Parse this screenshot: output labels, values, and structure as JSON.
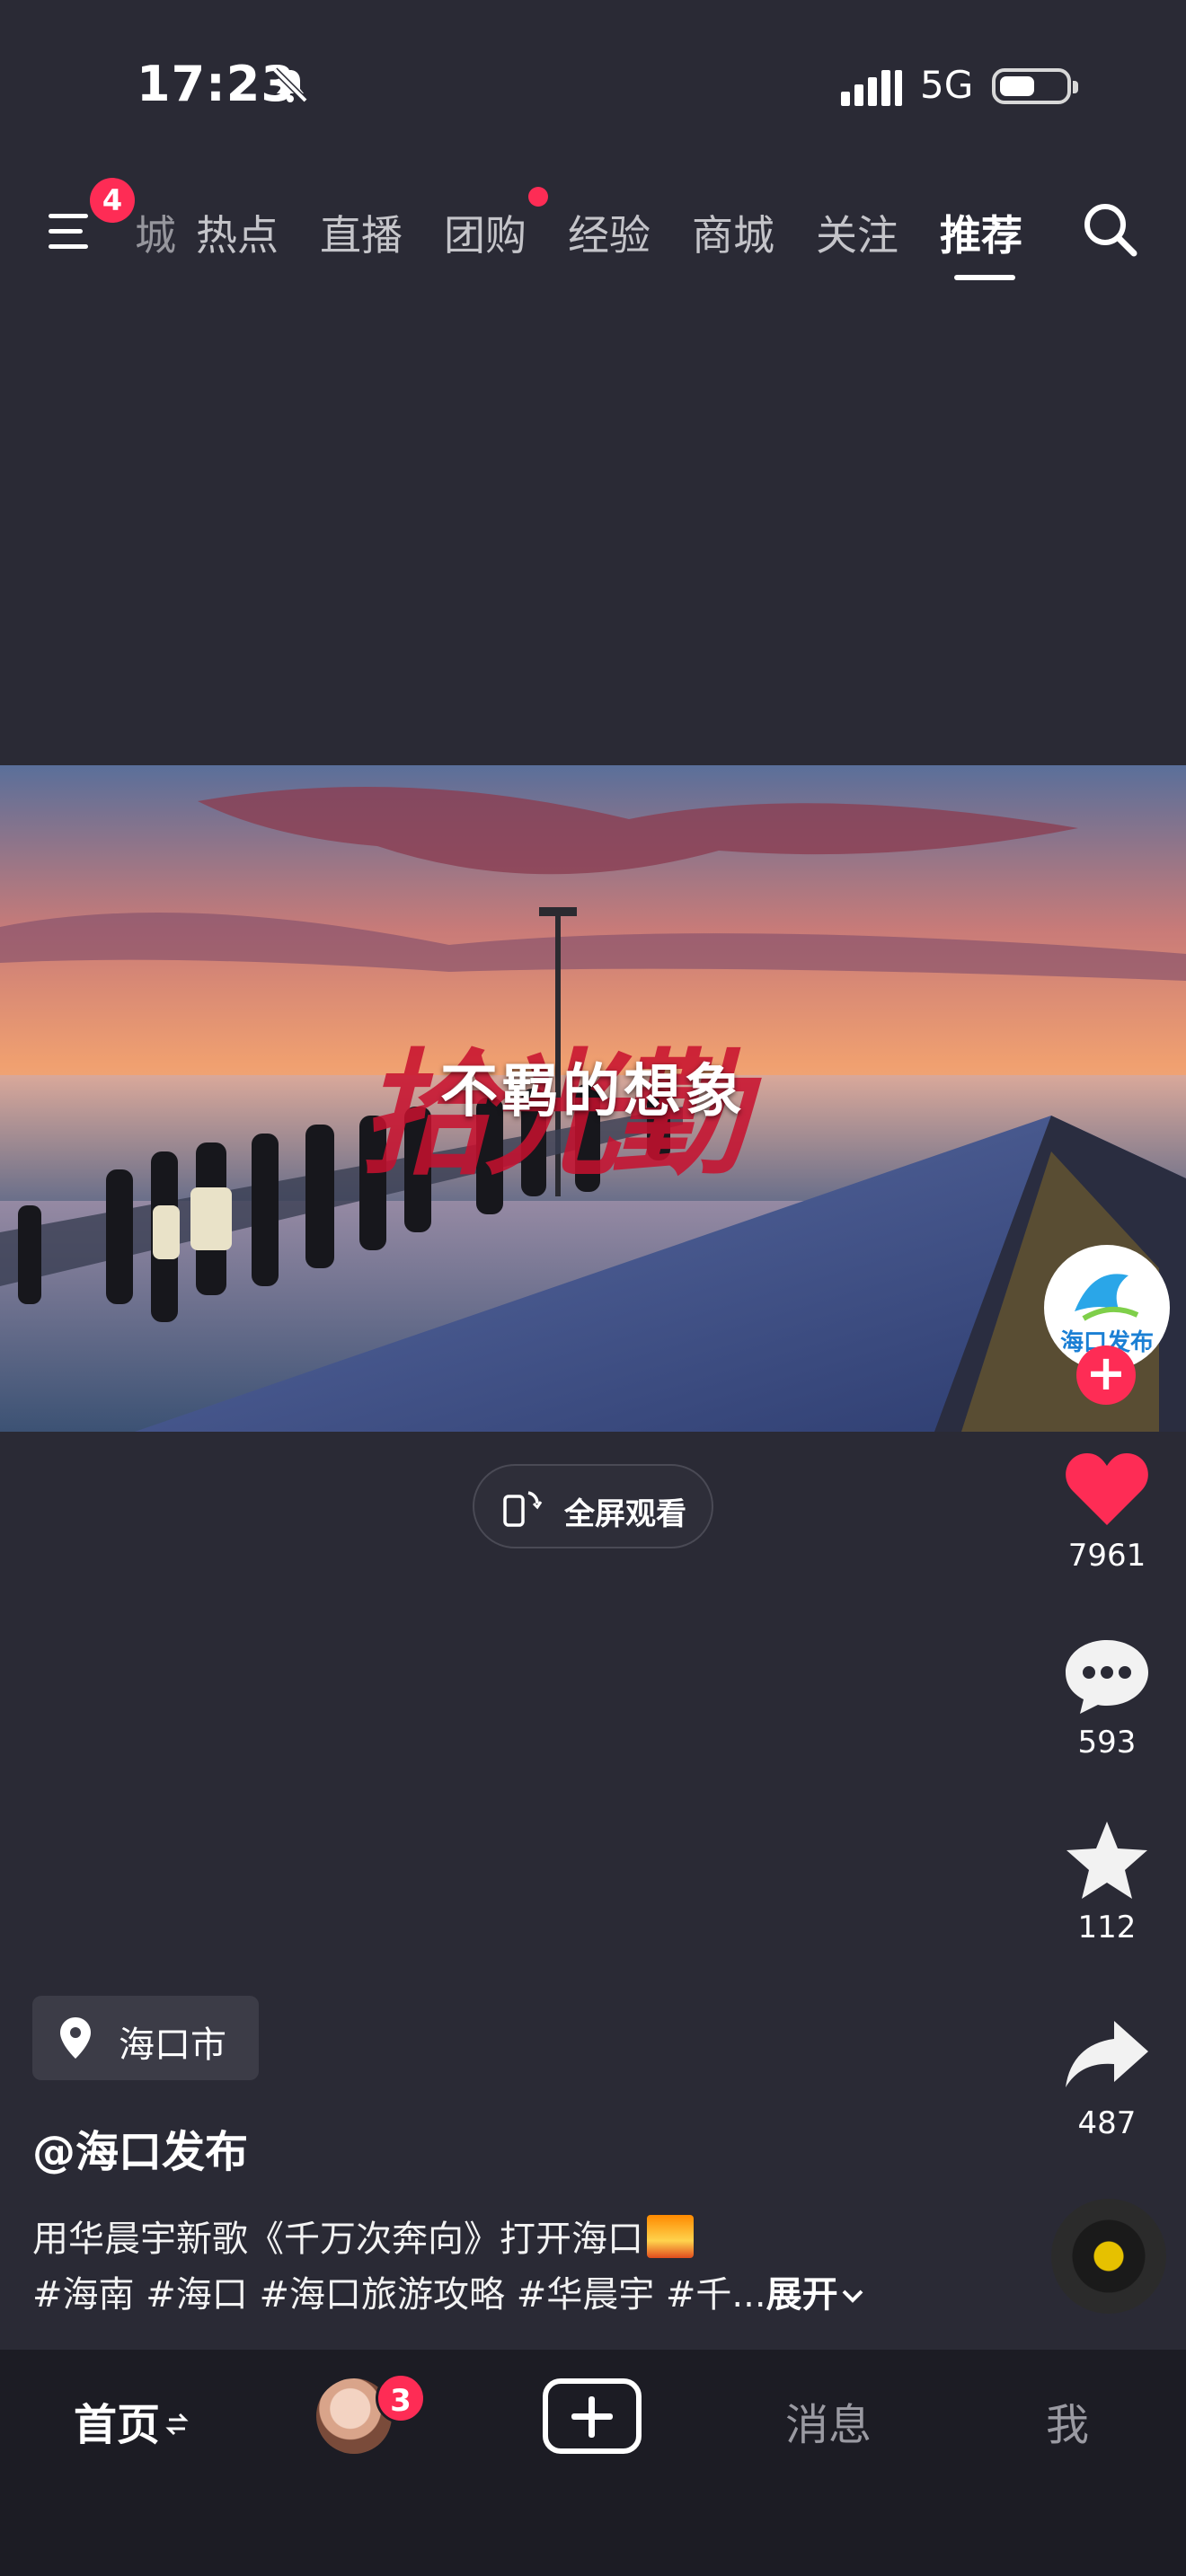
{
  "status_bar": {
    "time": "17:23",
    "network": "5G"
  },
  "top_nav": {
    "menu_badge": "4",
    "partial_tab": "城",
    "tabs": [
      "热点",
      "直播",
      "团购",
      "经验",
      "商城",
      "关注",
      "推荐"
    ],
    "active_tab": "推荐"
  },
  "video": {
    "overlay_text": "不羁的想象",
    "brush_text": "拾光勤",
    "fullscreen_label": "全屏观看"
  },
  "actions": {
    "creator_name_on_avatar": "海口发布",
    "likes": "7961",
    "comments": "593",
    "favorites": "112",
    "shares": "487"
  },
  "info": {
    "location": "海口市",
    "author": "@海口发布",
    "caption_line1": "用华晨宇新歌《千万次奔向》打开海口",
    "caption_line2": "#海南 #海口 #海口旅游攻略 #华晨宇 #千...",
    "expand_label": "展开"
  },
  "bottom_nav": {
    "home": "首页",
    "friends_badge": "3",
    "messages": "消息",
    "me": "我"
  },
  "colors": {
    "accent": "#fe2c55",
    "background": "#2a2a35"
  }
}
